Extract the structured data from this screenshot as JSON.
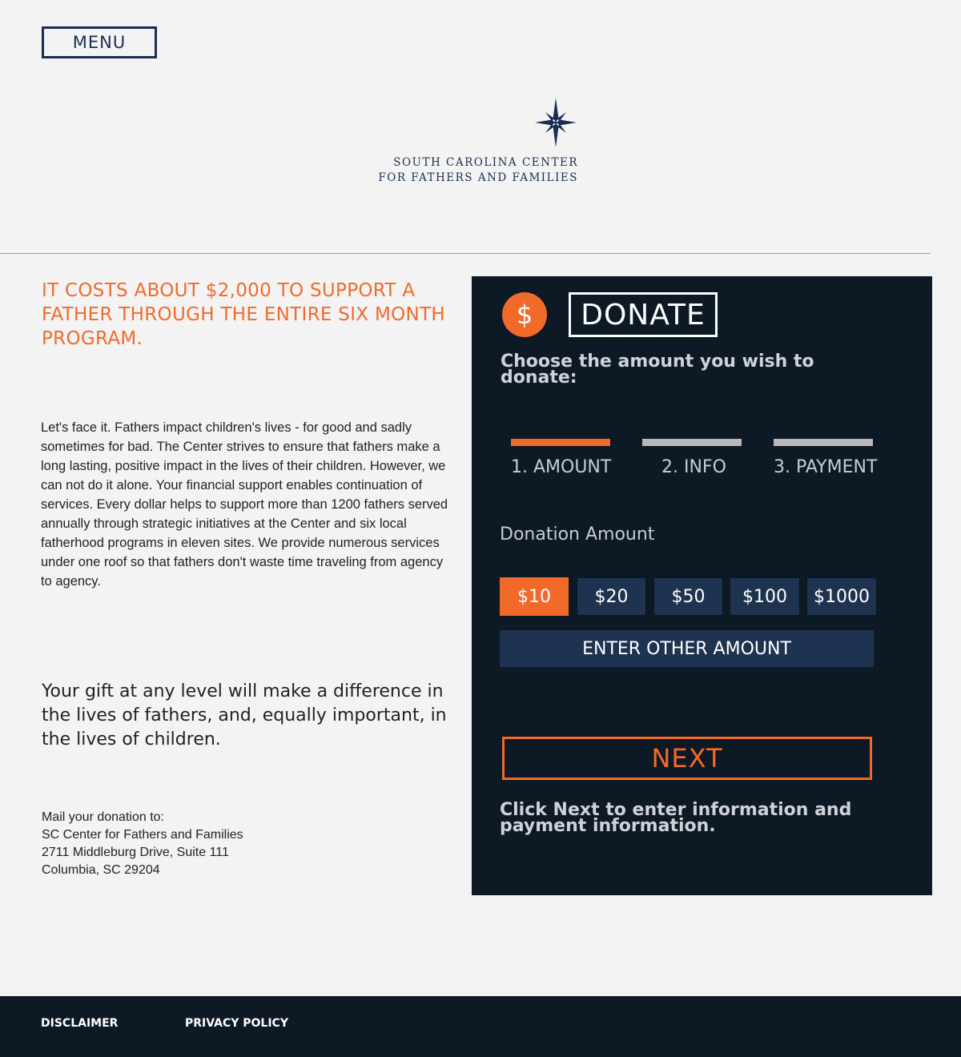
{
  "header": {
    "menu_label": "MENU",
    "logo": {
      "icon": "compass-star-icon",
      "line1": "SOUTH CAROLINA CENTER",
      "line2": "FOR FATHERS AND FAMILIES"
    }
  },
  "intro": {
    "headline": "IT COSTS ABOUT $2,000 TO SUPPORT A FATHER THROUGH THE ENTIRE SIX MONTH PROGRAM.",
    "body": "Let's face it. Fathers impact children's lives - for good and sadly sometimes for bad.  The Center strives to ensure that fathers make a long lasting, positive impact in the lives of their children.  However, we can not do it alone. Your financial support enables continuation of services.  Every dollar helps to support more than 1200 fathers served annually through strategic initiatives at the Center and six local fatherhood programs in eleven sites.  We provide numerous services under one roof so that fathers don't waste time traveling from agency to agency.",
    "gift": "Your gift at any level will make a difference in the lives of fathers, and, equally important, in the lives of children.",
    "mail": {
      "line1": "Mail your donation to:",
      "line2": "SC Center for Fathers and Families",
      "line3": "2711 Middleburg Drive, Suite 111",
      "line4": "Columbia, SC 29204"
    }
  },
  "donate": {
    "icon_symbol": "$",
    "title": "DONATE",
    "choose_text": "Choose the amount you wish to donate:",
    "steps": [
      {
        "label": "1. AMOUNT",
        "active": true
      },
      {
        "label": "2. INFO",
        "active": false
      },
      {
        "label": "3. PAYMENT",
        "active": false
      }
    ],
    "amount_label": "Donation Amount",
    "amounts": [
      "$10",
      "$20",
      "$50",
      "$100",
      "$1000"
    ],
    "selected_amount": "$10",
    "other_label": "ENTER OTHER AMOUNT",
    "next_label": "NEXT",
    "hint": "Click Next to enter information and payment information."
  },
  "footer": {
    "disclaimer": "DISCLAIMER",
    "privacy": "PRIVACY POLICY"
  },
  "colors": {
    "accent": "#f26a2a",
    "navy": "#1a2e55",
    "panel": "#0e1926",
    "button": "#1e3350"
  }
}
